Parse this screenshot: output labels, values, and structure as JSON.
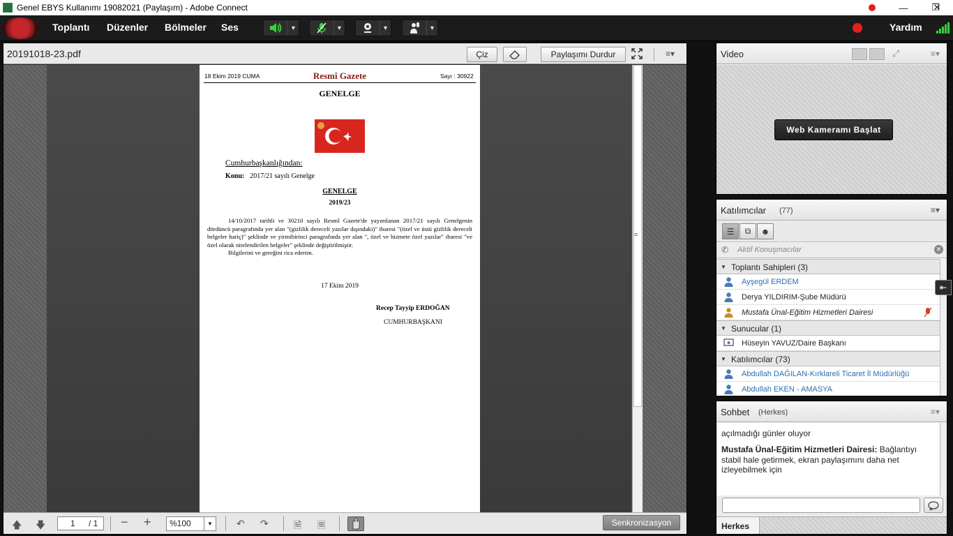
{
  "window": {
    "title": "Genel EBYS Kullanımı  19082021 (Paylaşım) - Adobe Connect"
  },
  "menu": {
    "items": [
      "Toplantı",
      "Düzenler",
      "Bölmeler",
      "Ses"
    ],
    "help": "Yardım"
  },
  "share": {
    "filename": "20191018-23.pdf",
    "draw_label": "Çiz",
    "stop_sharing_label": "Paylaşımı Durdur",
    "page_current": "1",
    "page_total": "/ 1",
    "zoom": "%100",
    "sync_label": "Senkronizasyon"
  },
  "document": {
    "header_date": "18 Ekim 2019 CUMA",
    "header_title": "Resmî Gazete",
    "header_number": "Sayı : 30922",
    "heading": "GENELGE",
    "authority": "Cumhurbaşkanlığından:",
    "subject_label": "Konu:",
    "subject_value": "2017/21 sayılı Genelge",
    "title2": "GENELGE",
    "number2": "2019/23",
    "body": "14/10/2017 tarihli ve 30210 sayılı Resmî Gazete'de yayımlanan 2017/21 sayılı Genelgenin dördüncü paragrafında yer alan \"(gizlilik dereceli yazılar dışındaki)\" ibaresi \"(özel ve üstü gizlilik dereceli belgeler hariç)\" şeklinde ve yirmibirinci paragrafında yer alan \", özel ve hizmete özel yazılar\" ibaresi \"ve özel olarak nitelendirilen belgeler\" şeklinde değiştirilmiştir.",
    "closing": "Bilgilerini ve gereğini rica ederim.",
    "date": "17 Ekim 2019",
    "signer": "Recep Tayyip ERDOĞAN",
    "signer_title": "CUMHURBAŞKANI"
  },
  "video": {
    "title": "Video",
    "start_webcam": "Web Kameramı Başlat"
  },
  "attendees": {
    "title": "Katılımcılar",
    "count": "(77)",
    "active_speakers": "Aktif Konuşmacılar",
    "groups": [
      {
        "label": "Toplantı Sahipleri (3)",
        "members": [
          {
            "name": "Ayşegül ERDEM",
            "style": "link"
          },
          {
            "name": "Derya YILDIRIM-Şube Müdürü",
            "style": "plain"
          },
          {
            "name": "Mustafa Ünal-Eğitim Hizmetleri Dairesi",
            "style": "italic"
          }
        ]
      },
      {
        "label": "Sunucular (1)",
        "members": [
          {
            "name": "Hüseyin YAVUZ/Daire Başkanı",
            "style": "plain"
          }
        ]
      },
      {
        "label": "Katılımcılar (73)",
        "members": [
          {
            "name": "Abdullah DAĞILAN-Kırklareli Ticaret İl Müdürlüğü",
            "style": "link"
          },
          {
            "name": "Abdullah EKEN - AMASYA",
            "style": "link"
          }
        ]
      }
    ]
  },
  "chat": {
    "title": "Sohbet",
    "audience": "(Herkes)",
    "line1": "açılmadığı günler oluyor",
    "sender": "Mustafa Ünal-Eğitim Hizmetleri Dairesi:",
    "message": "Bağlantıyı stabil hale getirmek, ekran paylaşımını daha net izleyebilmek için",
    "tab": "Herkes"
  },
  "colors": {
    "accent_red": "#e02020",
    "link_blue": "#2a6fb0",
    "menubar": "#1b1b1b"
  }
}
